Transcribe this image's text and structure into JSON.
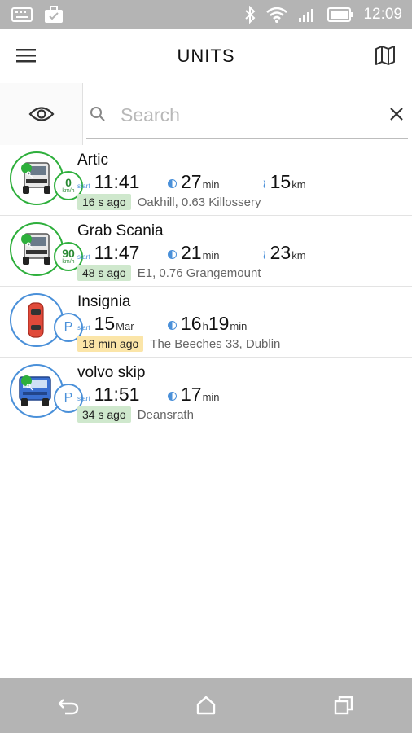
{
  "status_bar": {
    "time": "12:09",
    "icons": [
      "keyboard-icon",
      "briefcase-icon",
      "bluetooth-icon",
      "wifi-icon",
      "signal-icon",
      "battery-icon"
    ]
  },
  "app_bar": {
    "title": "UNITS",
    "left_icon": "hamburger-menu-icon",
    "right_icon": "map-icon"
  },
  "search": {
    "placeholder": "Search",
    "value": ""
  },
  "units": [
    {
      "name": "Artic",
      "vehicle": "truck-white",
      "status_icon": "speed",
      "speed": "0",
      "speed_unit": "km/h",
      "start_label": "start",
      "start_value": "11:41",
      "start_unit": "",
      "duration_h": "",
      "duration_h_unit": "",
      "duration_m": "27",
      "duration_m_unit": "min",
      "distance": "15",
      "distance_unit": "km",
      "ago": "16 s ago",
      "ago_color": "green",
      "address": "Oakhill, 0.63  Killossery",
      "ring_color": "#2eaf3c"
    },
    {
      "name": "Grab Scania",
      "vehicle": "truck-white",
      "status_icon": "speed",
      "speed": "90",
      "speed_unit": "km/h",
      "start_label": "start",
      "start_value": "11:47",
      "start_unit": "",
      "duration_h": "",
      "duration_h_unit": "",
      "duration_m": "21",
      "duration_m_unit": "min",
      "distance": "23",
      "distance_unit": "km",
      "ago": "48 s ago",
      "ago_color": "green",
      "address": "E1, 0.76  Grangemount",
      "ring_color": "#2eaf3c"
    },
    {
      "name": "Insignia",
      "vehicle": "car-red",
      "status_icon": "parked",
      "park_label": "P",
      "start_label": "start",
      "start_value": "15",
      "start_unit": "Mar",
      "duration_h": "16",
      "duration_h_unit": "h",
      "duration_m": "19",
      "duration_m_unit": "min",
      "distance": "",
      "distance_unit": "",
      "ago": "18 min ago",
      "ago_color": "yellow",
      "address": "The Beeches 33, Dublin",
      "ring_color": "#4a90d9"
    },
    {
      "name": "volvo skip",
      "vehicle": "truck-blue",
      "status_icon": "parked",
      "park_label": "P",
      "start_label": "start",
      "start_value": "11:51",
      "start_unit": "",
      "duration_h": "",
      "duration_h_unit": "",
      "duration_m": "17",
      "duration_m_unit": "min",
      "distance": "",
      "distance_unit": "",
      "ago": "34 s ago",
      "ago_color": "green",
      "address": "Deansrath",
      "ring_color": "#4a90d9"
    }
  ],
  "nav_bar": {
    "icons": [
      "back-icon",
      "home-icon",
      "recents-icon"
    ]
  },
  "colors": {
    "green": "#2eaf3c",
    "blue": "#4a90d9",
    "chrome_gray": "#b4b4b4"
  }
}
